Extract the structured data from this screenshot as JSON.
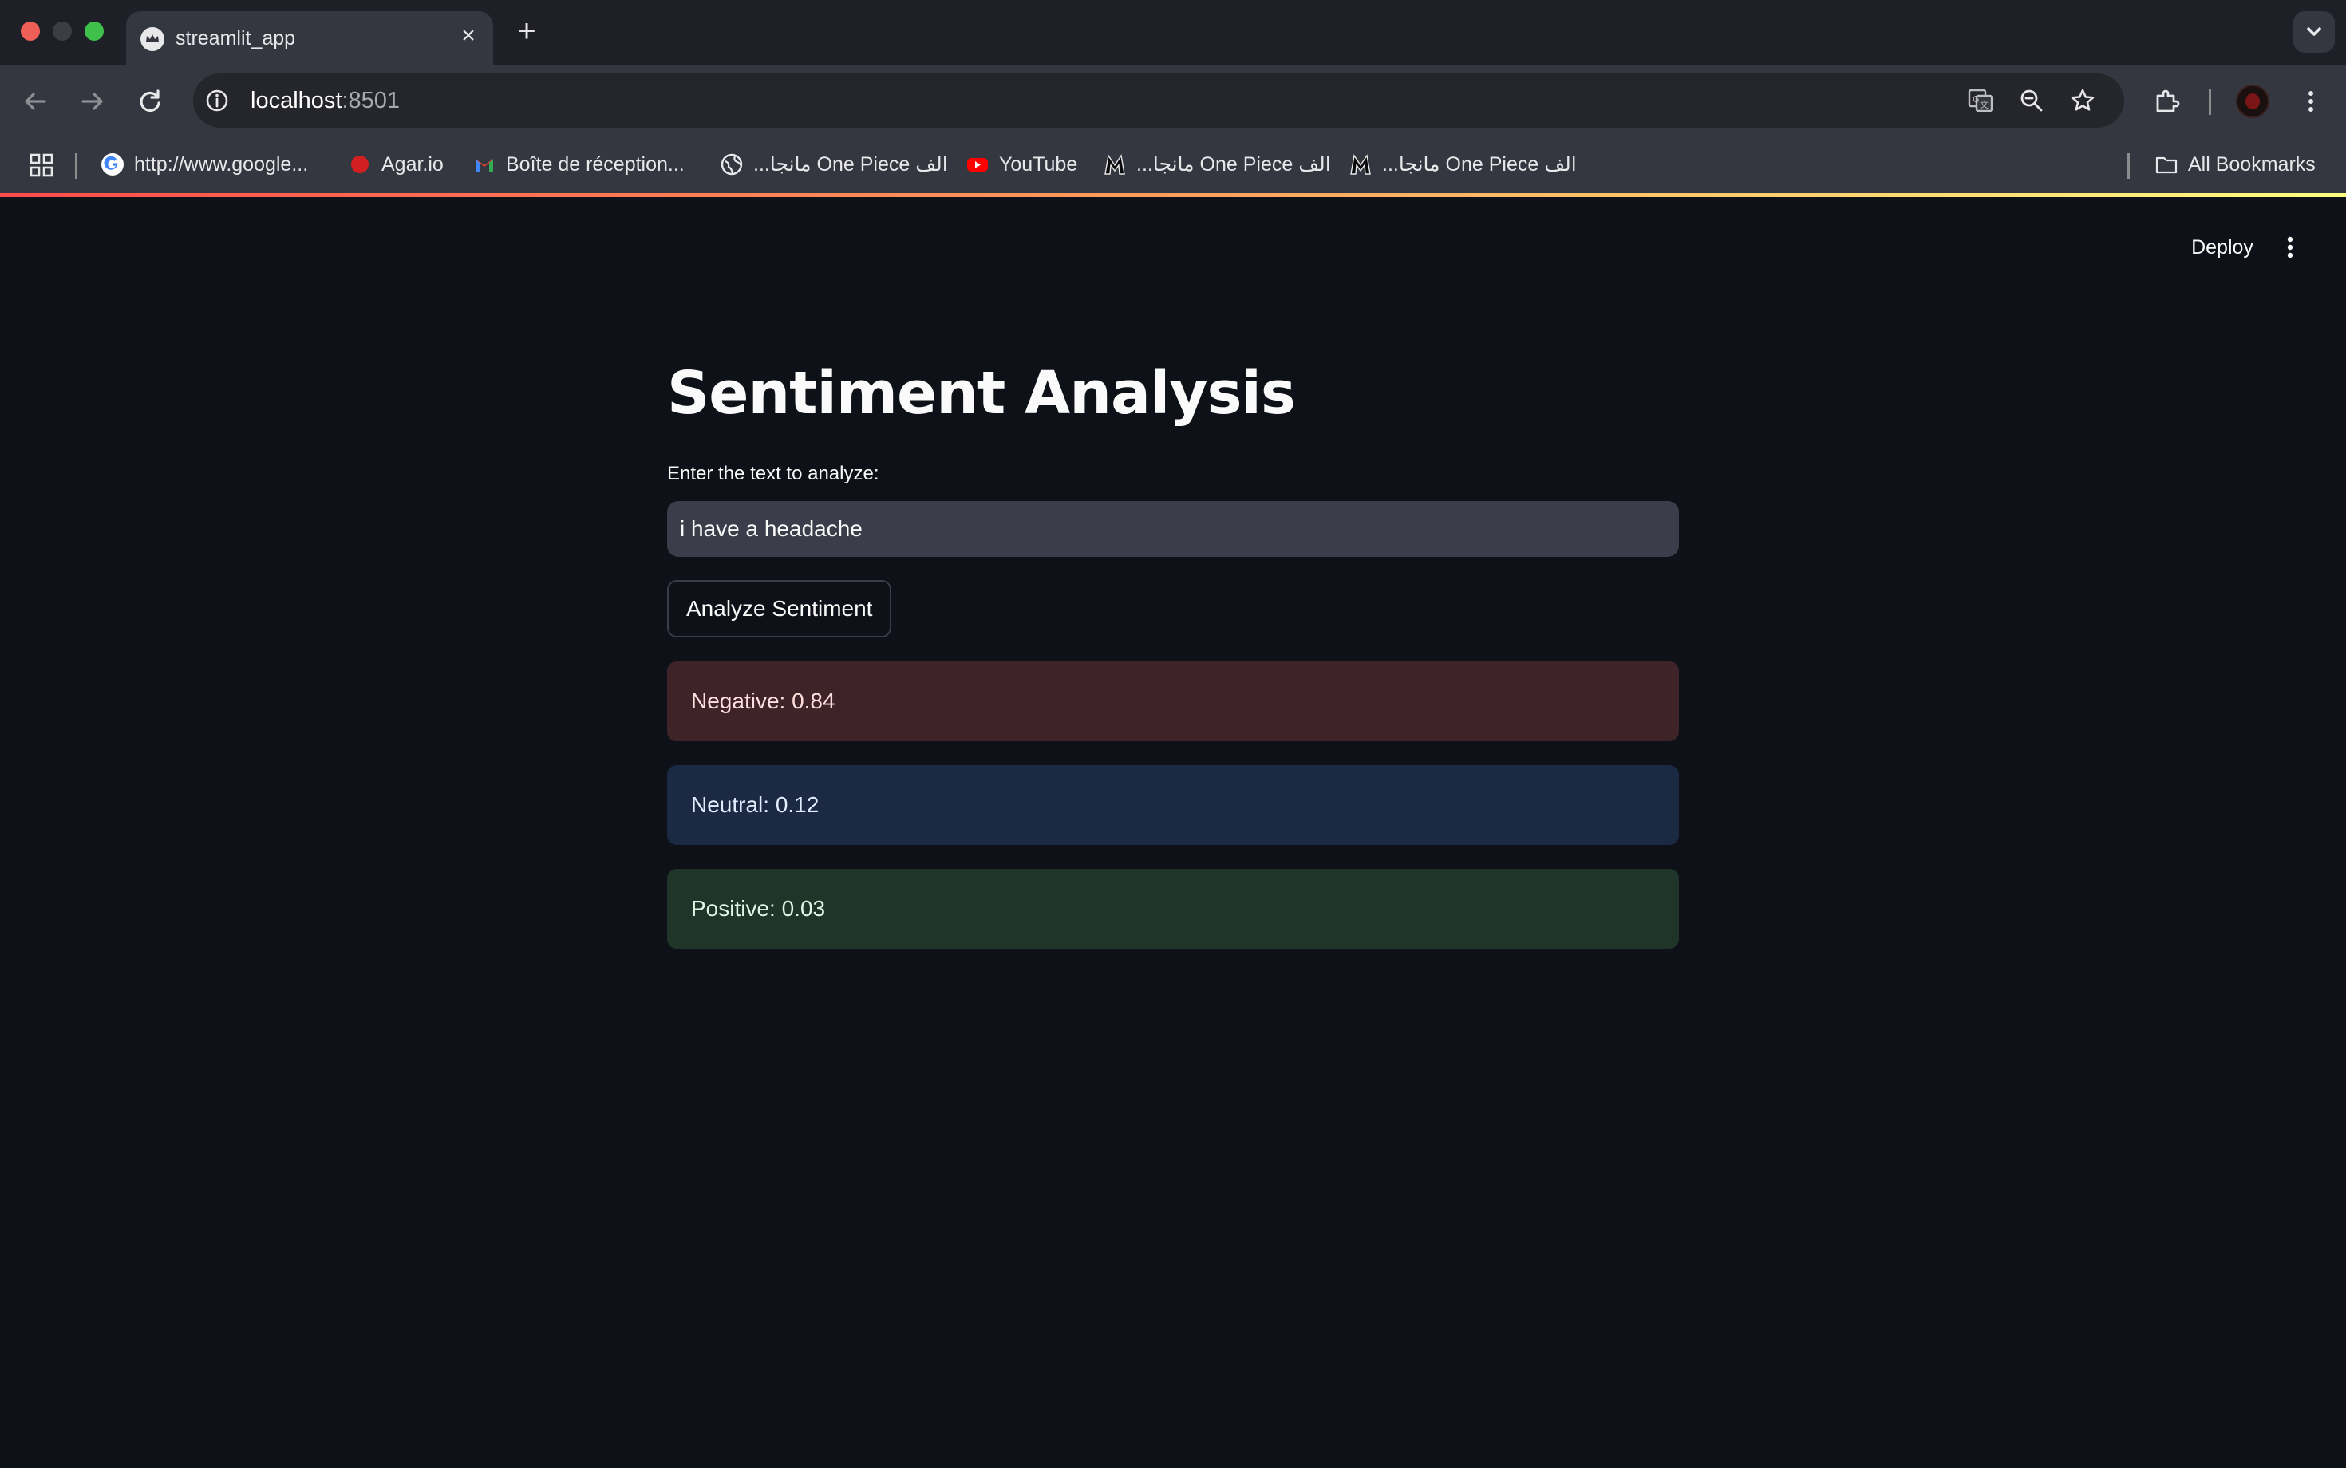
{
  "browser": {
    "tab_title": "streamlit_app",
    "url_host": "localhost",
    "url_port": ":8501",
    "bookmarks": [
      {
        "label": "http://www.google...",
        "icon": "google-icon"
      },
      {
        "label": "Agar.io",
        "icon": "agar-icon"
      },
      {
        "label": "Boîte de réception...",
        "icon": "gmail-icon"
      },
      {
        "label": "...مانجا One Piece الف",
        "icon": "globe-icon"
      },
      {
        "label": "YouTube",
        "icon": "youtube-icon"
      },
      {
        "label": "...مانجا One Piece الف",
        "icon": "manga-icon"
      },
      {
        "label": "...مانجا One Piece الف",
        "icon": "manga-icon"
      }
    ],
    "all_bookmarks_label": "All Bookmarks"
  },
  "app": {
    "deploy_label": "Deploy",
    "title": "Sentiment Analysis",
    "input_label": "Enter the text to analyze:",
    "input_value": "i have a headache",
    "button_label": "Analyze Sentiment",
    "results": {
      "negative": "Negative: 0.84",
      "neutral": "Neutral: 0.12",
      "positive": "Positive: 0.03"
    }
  },
  "colors": {
    "background": "#0e1117",
    "negative_bg": "#3e2428",
    "neutral_bg": "#1b2a42",
    "positive_bg": "#213429",
    "accent": "#ff4b4b"
  }
}
